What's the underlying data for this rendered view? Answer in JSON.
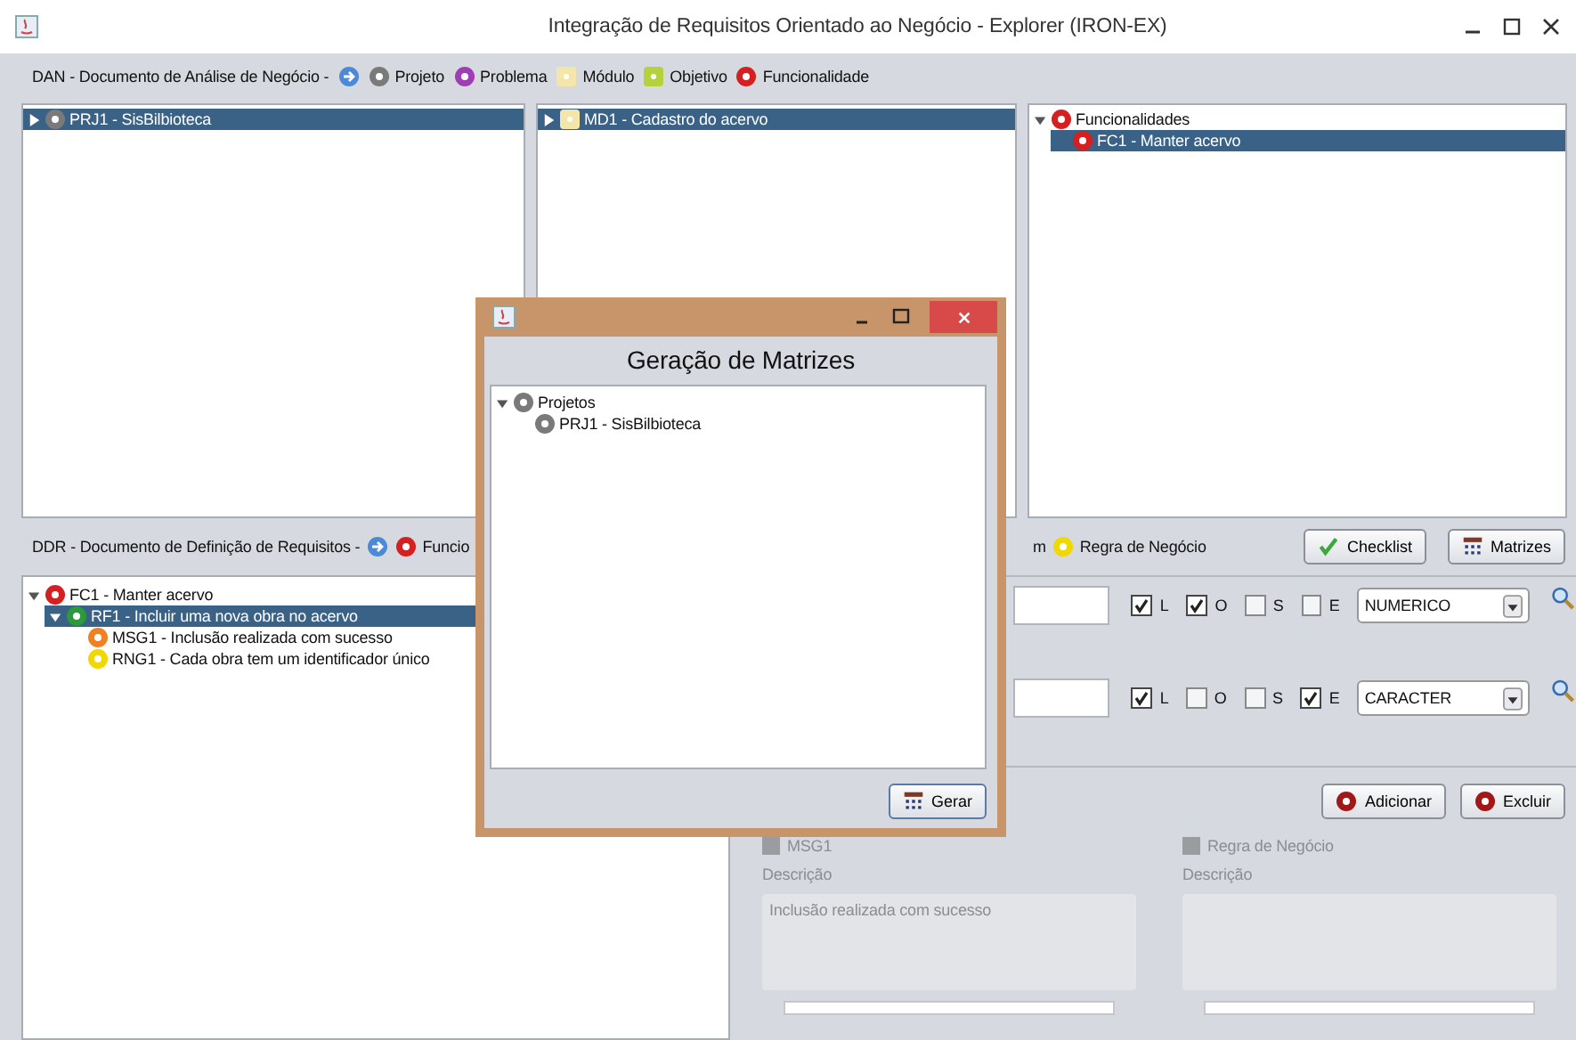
{
  "window": {
    "title": "Integração de Requisitos Orientado ao Negócio - Explorer (IRON-EX)"
  },
  "dan": {
    "title": "DAN - Documento de Análise de Negócio -",
    "legend": [
      {
        "label": "Projeto",
        "kind": "circle",
        "color": "#7a7a7a"
      },
      {
        "label": "Problema",
        "kind": "circle",
        "color": "#a03cb4"
      },
      {
        "label": "Módulo",
        "kind": "square",
        "color": "#f4e6a8"
      },
      {
        "label": "Objetivo",
        "kind": "square",
        "color": "#b4d23c"
      },
      {
        "label": "Funcionalidade",
        "kind": "circle",
        "color": "#d42020"
      }
    ]
  },
  "dan_panels": [
    {
      "nodes": [
        {
          "label": "PRJ1 - SisBilbioteca",
          "kind": "circle",
          "color": "#7a7a7a",
          "selected": true,
          "expanded": false
        }
      ]
    },
    {
      "nodes": [
        {
          "label": "MD1 - Cadastro do acervo",
          "kind": "square",
          "color": "#f4e6a8",
          "selected": true,
          "expanded": false
        }
      ]
    },
    {
      "nodes": [
        {
          "label": "Funcionalidades",
          "kind": "circle",
          "color": "#d42020",
          "selected": false,
          "expanded": true,
          "children": [
            {
              "label": "FC1 - Manter acervo",
              "kind": "circle",
              "color": "#d42020",
              "selected": true
            }
          ]
        }
      ]
    }
  ],
  "ddr": {
    "title": "DDR - Documento de Definição de Requisitos -",
    "legend": [
      {
        "label": "Funcio",
        "kind": "circle",
        "color": "#d42020"
      }
    ],
    "fragment": "m",
    "legend_right": [
      {
        "label": "Regra de Negócio",
        "kind": "circle",
        "color": "#f0d800"
      }
    ],
    "buttons": [
      {
        "label": "Checklist",
        "kind": "check"
      },
      {
        "label": "Matrizes",
        "kind": "grid"
      }
    ]
  },
  "ddr_tree": [
    {
      "label": "FC1 - Manter acervo",
      "kind": "circle",
      "color": "#d42020",
      "selected": false,
      "expanded": true,
      "children": [
        {
          "label": "RF1 - Incluir uma nova obra no acervo",
          "kind": "circle",
          "color": "#2a9a3a",
          "selected": true,
          "expanded": true,
          "children": [
            {
              "label": "MSG1 - Inclusão realizada com sucesso",
              "kind": "circle",
              "color": "#f08020",
              "selected": false
            },
            {
              "label": "RNG1 - Cada obra tem um identificador único",
              "kind": "circle",
              "color": "#f0d800",
              "selected": false
            }
          ]
        }
      ]
    }
  ],
  "form_rows": [
    {
      "checks": [
        {
          "label": "L",
          "checked": true
        },
        {
          "label": "O",
          "checked": true
        },
        {
          "label": "S",
          "checked": false
        },
        {
          "label": "E",
          "checked": false
        }
      ],
      "type": "NUMERICO"
    },
    {
      "checks": [
        {
          "label": "L",
          "checked": true
        },
        {
          "label": "O",
          "checked": false
        },
        {
          "label": "S",
          "checked": false
        },
        {
          "label": "E",
          "checked": true
        }
      ],
      "type": "CARACTER"
    }
  ],
  "form_buttons": [
    "Adicionar",
    "Excluir"
  ],
  "details": [
    {
      "label": "MSG1",
      "description_label": "Descrição",
      "description": "Inclusão realizada com sucesso",
      "disabled": true
    },
    {
      "label": "Regra de Negócio",
      "description_label": "Descrição",
      "disabled": true
    }
  ],
  "dialog": {
    "title": "Geração de Matrizes",
    "tree": [
      {
        "label": "Projetos",
        "kind": "circle",
        "color": "#7a7a7a",
        "selected": false,
        "expanded": true,
        "children": [
          {
            "label": "PRJ1 - SisBilbioteca",
            "kind": "circle",
            "color": "#7a7a7a",
            "selected": false
          }
        ]
      }
    ],
    "button": "Gerar"
  }
}
